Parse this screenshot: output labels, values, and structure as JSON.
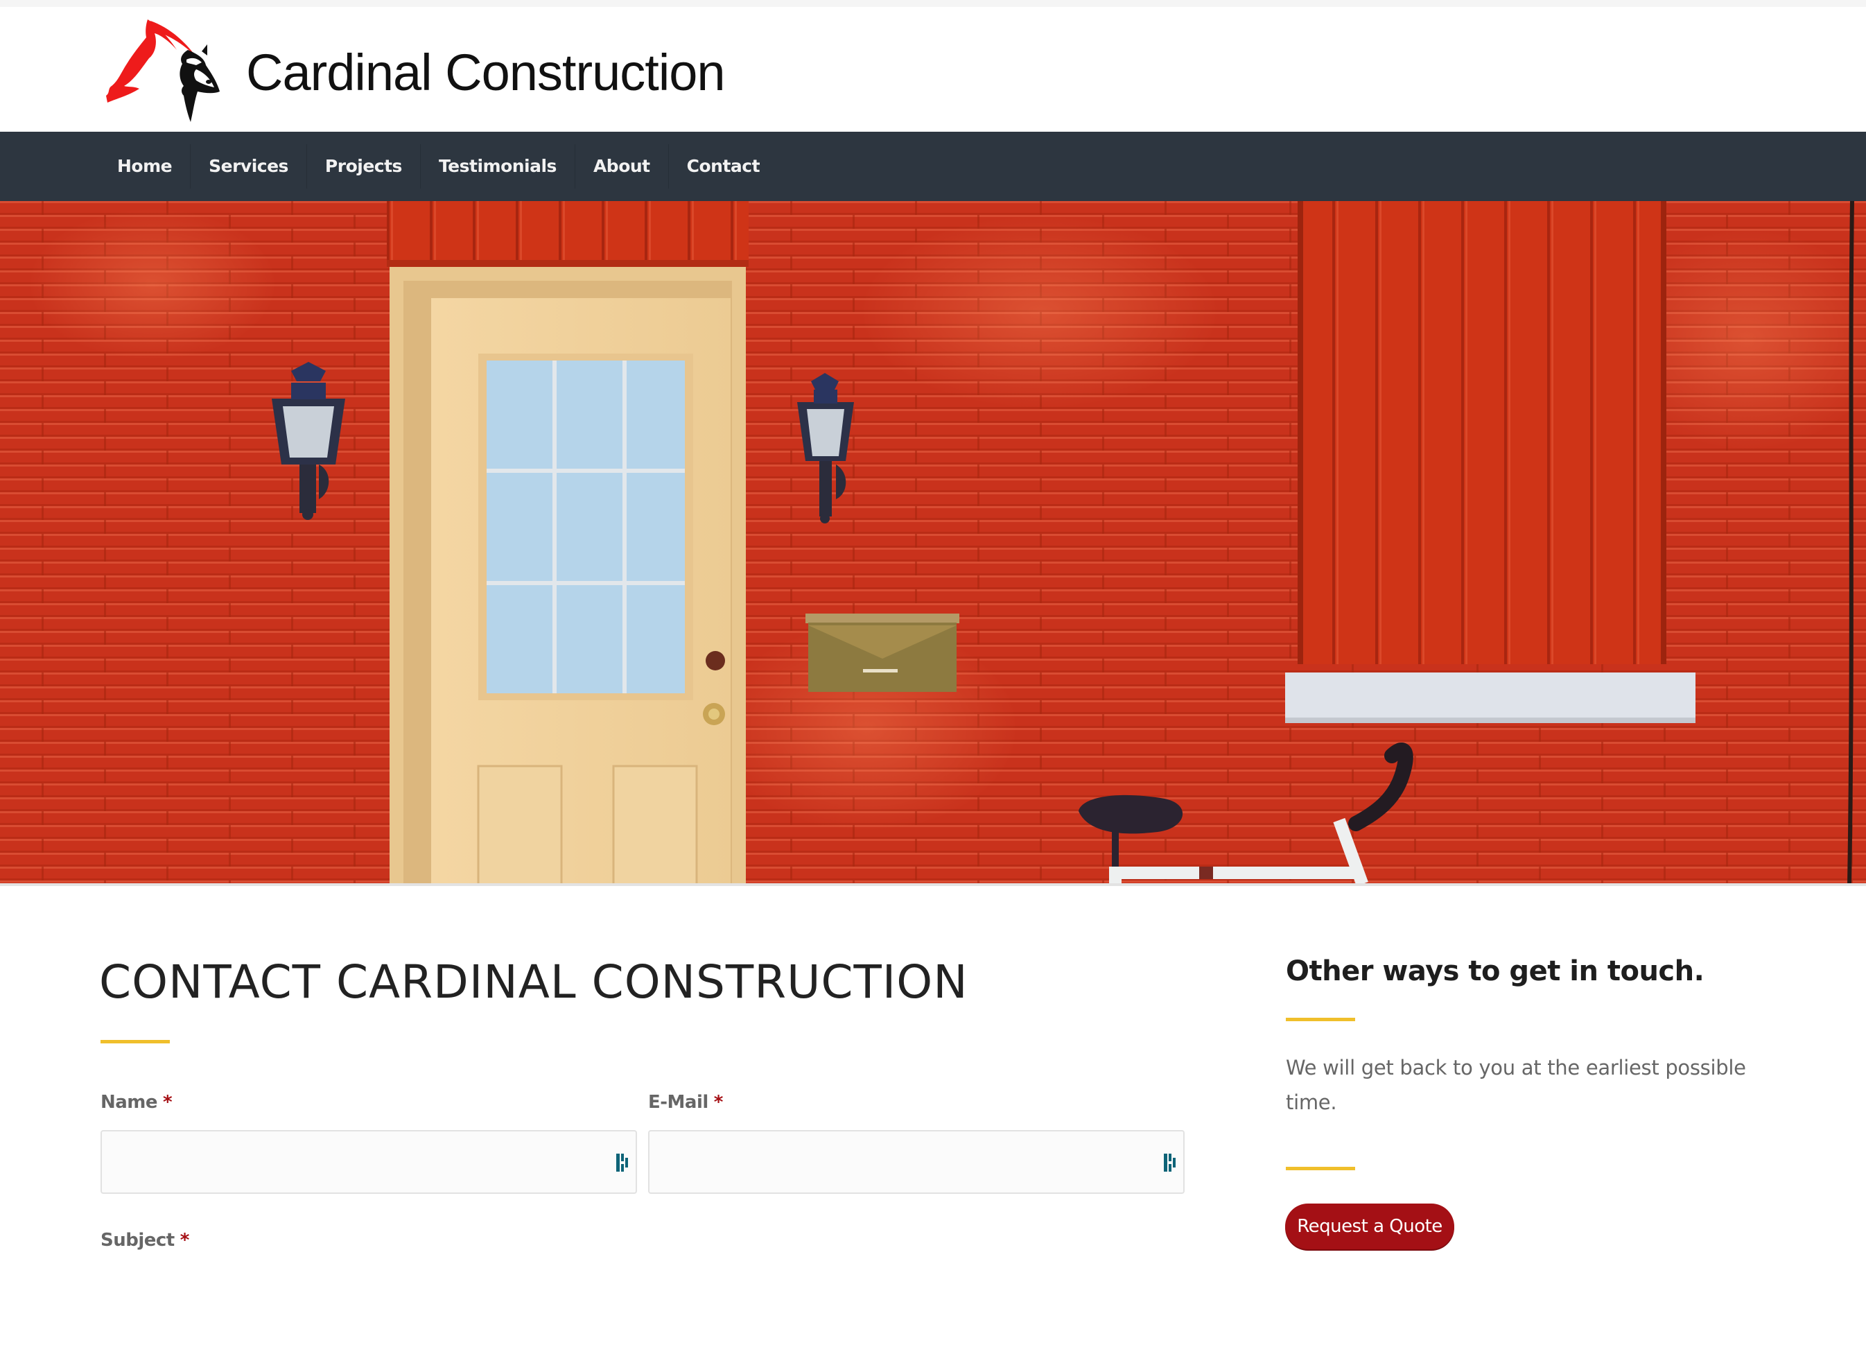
{
  "header": {
    "brand_name": "Cardinal Construction",
    "logo_icon": "cardinal-bird-logo"
  },
  "nav": {
    "items": [
      {
        "label": "Home"
      },
      {
        "label": "Services"
      },
      {
        "label": "Projects"
      },
      {
        "label": "Testimonials"
      },
      {
        "label": "About"
      },
      {
        "label": "Contact"
      }
    ]
  },
  "hero": {
    "description": "Red brick wall with cream door, lantern wall lamps, brass mailbox, red shuttered window and bicycle"
  },
  "contact_form": {
    "heading": "CONTACT CARDINAL CONSTRUCTION",
    "required_marker": "*",
    "fields": {
      "name": {
        "label": "Name",
        "value": "",
        "placeholder": ""
      },
      "email": {
        "label": "E-Mail",
        "value": "",
        "placeholder": ""
      },
      "subject": {
        "label": "Subject"
      }
    },
    "field_icon": "password-manager-icon"
  },
  "sidebar": {
    "heading": "Other ways to get in touch.",
    "text": "We will get back to you at the earliest possible time.",
    "button_label": "Request a Quote"
  },
  "colors": {
    "navbar": "#2d3640",
    "accent_yellow": "#f0bf2b",
    "button_red": "#a41015",
    "required_red": "#a50f14",
    "brick_red": "#c8331d",
    "password_icon_teal": "#0e6478"
  }
}
